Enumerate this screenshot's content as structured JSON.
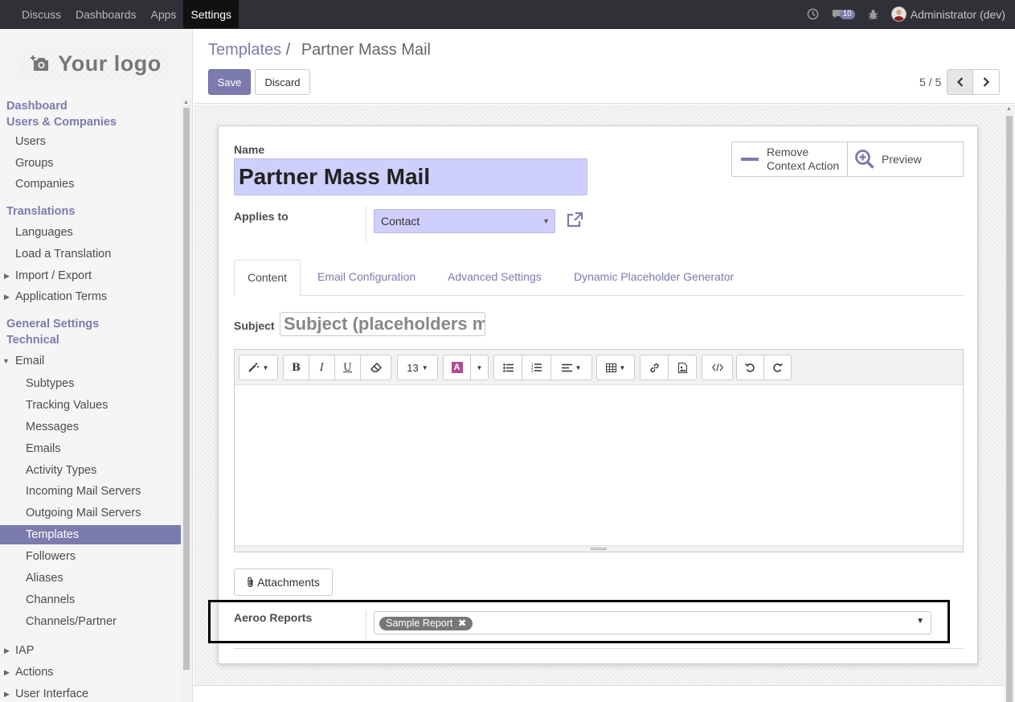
{
  "topbar": {
    "menu": [
      "Discuss",
      "Dashboards",
      "Apps",
      "Settings"
    ],
    "active_menu": "Settings",
    "message_count": "10",
    "user": "Administrator (dev)"
  },
  "sidebar": {
    "logo_text": "Your logo",
    "items": [
      {
        "label": "Dashboard",
        "kind": "section"
      },
      {
        "label": "Users & Companies",
        "kind": "section"
      },
      {
        "label": "Users",
        "kind": "item"
      },
      {
        "label": "Groups",
        "kind": "item"
      },
      {
        "label": "Companies",
        "kind": "item"
      },
      {
        "label": "Translations",
        "kind": "section"
      },
      {
        "label": "Languages",
        "kind": "item"
      },
      {
        "label": "Load a Translation",
        "kind": "item"
      },
      {
        "label": "Import / Export",
        "kind": "item",
        "expandable": true
      },
      {
        "label": "Application Terms",
        "kind": "item",
        "expandable": true
      },
      {
        "label": "General Settings",
        "kind": "section"
      },
      {
        "label": "Technical",
        "kind": "section"
      },
      {
        "label": "Email",
        "kind": "item",
        "expanded": true
      },
      {
        "label": "Subtypes",
        "kind": "subitem"
      },
      {
        "label": "Tracking Values",
        "kind": "subitem"
      },
      {
        "label": "Messages",
        "kind": "subitem"
      },
      {
        "label": "Emails",
        "kind": "subitem"
      },
      {
        "label": "Activity Types",
        "kind": "subitem"
      },
      {
        "label": "Incoming Mail Servers",
        "kind": "subitem"
      },
      {
        "label": "Outgoing Mail Servers",
        "kind": "subitem"
      },
      {
        "label": "Templates",
        "kind": "subitem",
        "selected": true
      },
      {
        "label": "Followers",
        "kind": "subitem"
      },
      {
        "label": "Aliases",
        "kind": "subitem"
      },
      {
        "label": "Channels",
        "kind": "subitem"
      },
      {
        "label": "Channels/Partner",
        "kind": "subitem"
      },
      {
        "label": "IAP",
        "kind": "item",
        "expandable": true
      },
      {
        "label": "Actions",
        "kind": "item",
        "expandable": true
      },
      {
        "label": "User Interface",
        "kind": "item",
        "expandable": true
      }
    ]
  },
  "breadcrumb": {
    "parent": "Templates",
    "separator": "/",
    "current": "Partner Mass Mail"
  },
  "buttons": {
    "save": "Save",
    "discard": "Discard"
  },
  "pager": {
    "text": "5 / 5"
  },
  "form": {
    "name_label": "Name",
    "name_value": "Partner Mass Mail",
    "remove_context_line1": "Remove",
    "remove_context_line2": "Context Action",
    "preview": "Preview",
    "applies_to_label": "Applies to",
    "applies_to_value": "Contact",
    "tabs": [
      "Content",
      "Email Configuration",
      "Advanced Settings",
      "Dynamic Placeholder Generator"
    ],
    "active_tab": "Content",
    "subject_label": "Subject",
    "subject_placeholder": "Subject (placeholders may be used here)",
    "font_size": "13",
    "attachments": "Attachments",
    "aeroo_label": "Aeroo Reports",
    "aeroo_tag": "Sample Report"
  },
  "colors": {
    "accent": "#7c7bad",
    "field_bg": "#cfcffb",
    "topbar": "#2f3136"
  }
}
